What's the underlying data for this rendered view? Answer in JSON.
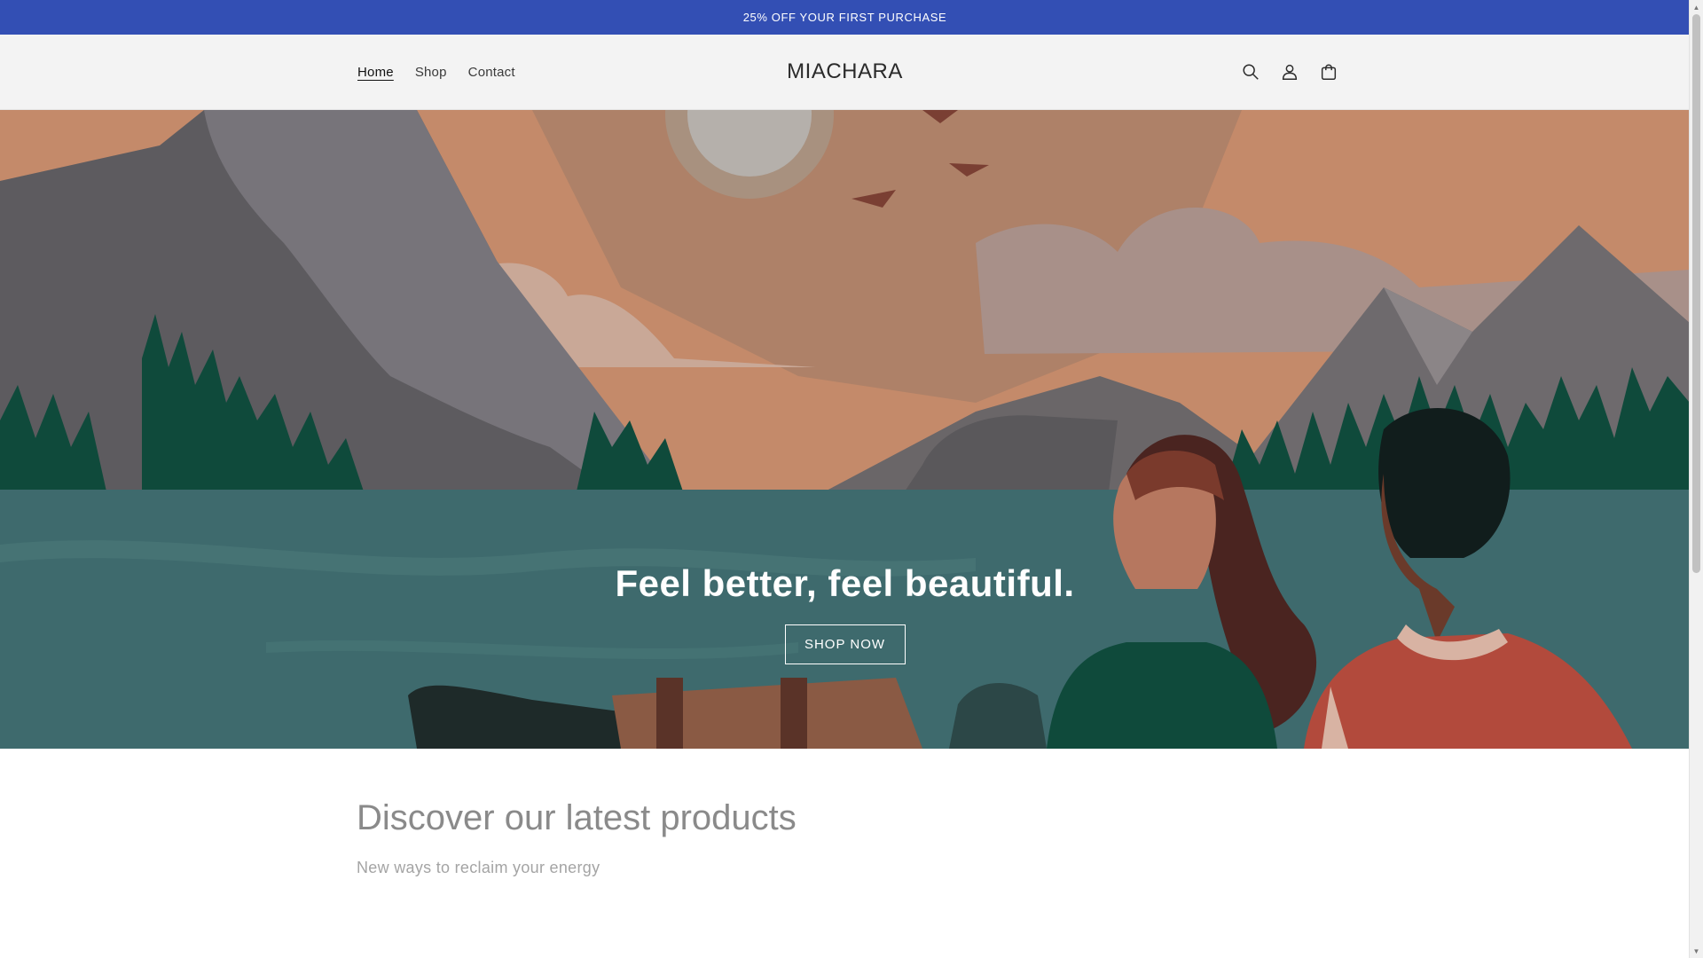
{
  "announcement": {
    "text": "25% OFF YOUR FIRST PURCHASE"
  },
  "header": {
    "logo": "MIACHARA",
    "nav": [
      {
        "label": "Home",
        "active": true
      },
      {
        "label": "Shop",
        "active": false
      },
      {
        "label": "Contact",
        "active": false
      }
    ],
    "icons": [
      "search-icon",
      "account-icon",
      "cart-icon"
    ]
  },
  "hero": {
    "title": "Feel better, feel beautiful.",
    "button_label": "SHOP NOW"
  },
  "products": {
    "title": "Discover our latest products",
    "subtitle": "New ways to reclaim your energy"
  },
  "colors": {
    "announcement_bg": "#334fb4",
    "header_bg": "#f3f3f3",
    "sky": "#c48a6a",
    "water": "#3e6a6d",
    "trees": "#0f4a3b"
  }
}
